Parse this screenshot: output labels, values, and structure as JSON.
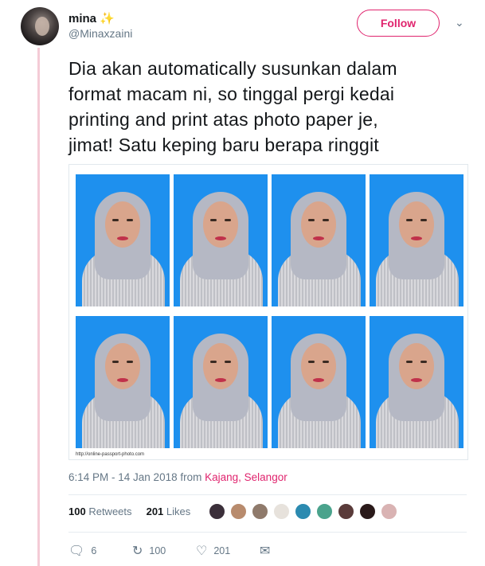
{
  "user": {
    "name": "mina",
    "emoji": "✨",
    "handle": "@Minaxzaini"
  },
  "header": {
    "follow_label": "Follow",
    "menu_icon": "chevron-down-icon"
  },
  "tweet": {
    "lines": [
      "Dia akan automatically susunkan dalam",
      "format macam ni, so tinggal pergi kedai",
      "printing and print atas photo paper je,",
      "jimat! Satu keping baru berapa ringgit"
    ]
  },
  "media": {
    "url_caption": "http://online-passport-photo.com",
    "photo_count": 8,
    "background_color": "#1e90ee"
  },
  "meta": {
    "timestamp": "6:14 PM - 14 Jan 2018",
    "from_text": "from",
    "location": "Kajang, Selangor"
  },
  "stats": {
    "retweets_count": "100",
    "retweets_label": "Retweets",
    "likes_count": "201",
    "likes_label": "Likes"
  },
  "likers_colors": [
    "#3b2f3a",
    "#b88b6d",
    "#8f7a6b",
    "#e7e2dc",
    "#2b8ab0",
    "#4aa38c",
    "#5a3b3a",
    "#2a1a1a",
    "#d9b3b3"
  ],
  "actions": {
    "reply_count": "6",
    "retweet_count": "100",
    "like_count": "201",
    "icons": [
      "reply-icon",
      "retweet-icon",
      "heart-icon",
      "message-icon"
    ]
  },
  "colors": {
    "accent": "#e0246e",
    "thread_line": "#f4cbd6",
    "muted_text": "#657786"
  }
}
